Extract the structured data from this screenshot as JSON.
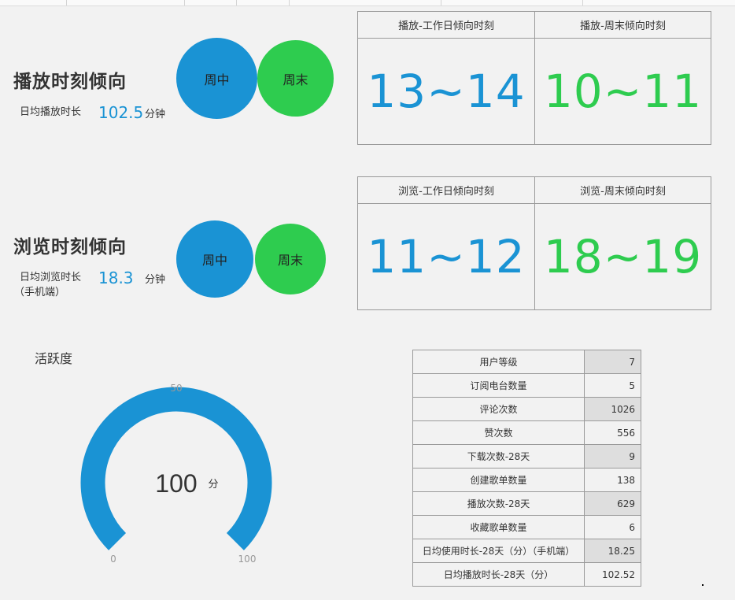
{
  "play": {
    "title": "播放时刻倾向",
    "daily_label": "日均播放时长",
    "daily_value": "102.5",
    "daily_unit": "分钟",
    "weekday_bubble": "周中",
    "weekend_bubble": "周末",
    "weekday_header": "播放-工作日倾向时刻",
    "weekend_header": "播放-周末倾向时刻",
    "weekday_hours": "13~14",
    "weekend_hours": "10~11"
  },
  "browse": {
    "title": "浏览时刻倾向",
    "daily_label": "日均浏览时长",
    "daily_sub": "（手机端）",
    "daily_value": "18.3",
    "daily_unit": "分钟",
    "weekday_bubble": "周中",
    "weekend_bubble": "周末",
    "weekday_header": "浏览-工作日倾向时刻",
    "weekend_header": "浏览-周末倾向时刻",
    "weekday_hours": "11~12",
    "weekend_hours": "18~19"
  },
  "gauge": {
    "title": "活跃度",
    "value": 100,
    "value_text": "100",
    "unit": "分",
    "min": 0,
    "mid": 50,
    "max": 100,
    "min_label": "0",
    "mid_label": "50",
    "max_label": "100",
    "color": "#1a93d4"
  },
  "stats_table": [
    {
      "label": "用户等级",
      "value": "7"
    },
    {
      "label": "订阅电台数量",
      "value": "5"
    },
    {
      "label": "评论次数",
      "value": "1026"
    },
    {
      "label": "赞次数",
      "value": "556"
    },
    {
      "label": "下载次数-28天",
      "value": "9"
    },
    {
      "label": "创建歌单数量",
      "value": "138"
    },
    {
      "label": "播放次数-28天",
      "value": "629"
    },
    {
      "label": "收藏歌单数量",
      "value": "6"
    },
    {
      "label": "日均使用时长-28天（分）（手机端）",
      "value": "18.25"
    },
    {
      "label": "日均播放时长-28天（分）",
      "value": "102.52"
    }
  ],
  "colors": {
    "blue": "#1a93d4",
    "green": "#2ecc4f"
  }
}
